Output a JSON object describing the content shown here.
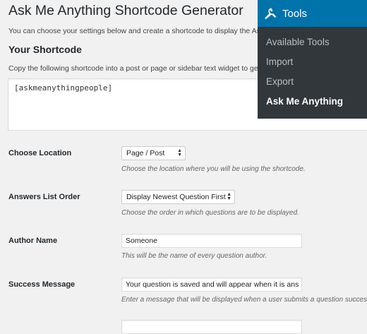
{
  "page": {
    "title": "Ask Me Anything Shortcode Generator",
    "intro": "You can choose your settings below and create a shortcode to display the Ask M"
  },
  "shortcode_section": {
    "heading": "Your Shortcode",
    "instructions": "Copy the following shortcode into a post or page or sidebar text widget to gener",
    "value": "[askmeanythingpeople]"
  },
  "fields": {
    "location": {
      "label": "Choose Location",
      "selected": "Page / Post",
      "description": "Choose the location where you will be using the shortcode."
    },
    "order": {
      "label": "Answers List Order",
      "selected": "Display Newest Question First",
      "description": "Choose the order in which questions are to be displayed."
    },
    "author": {
      "label": "Author Name",
      "value": "Someone",
      "description": "This will be the name of every question author."
    },
    "success": {
      "label": "Success Message",
      "value": "Your question is saved and will appear when it is ans",
      "description": "Enter a message that will be displayed when a user submits a question succes"
    }
  },
  "admin_menu": {
    "title": "Tools",
    "title_icon": "wrench-icon",
    "items": [
      "Available Tools",
      "Import",
      "Export",
      "Ask Me Anything"
    ],
    "current_index": 3,
    "colors": {
      "header_bg": "#0073aa",
      "menu_bg": "#32373c"
    }
  }
}
